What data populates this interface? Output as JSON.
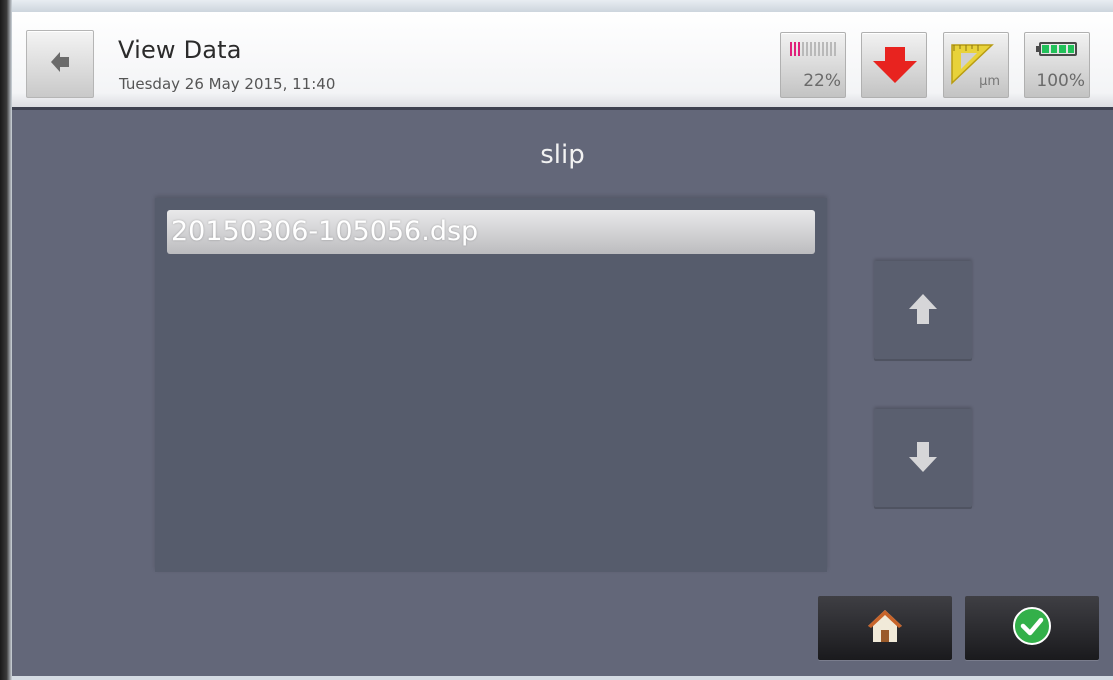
{
  "header": {
    "title": "View Data",
    "datetime": "Tuesday 26 May 2015, 11:40",
    "storage_label": "22%",
    "storage_fraction": 0.22,
    "units_label": "µm",
    "battery_label": "100%",
    "battery_fraction": 1.0
  },
  "main": {
    "folder_name": "slip",
    "files": [
      "20150306-105056.dsp"
    ]
  },
  "icons": {
    "back": "back-arrow-icon",
    "download": "download-arrow-icon",
    "units": "ruler-triangle-icon",
    "battery": "battery-icon",
    "up": "arrow-up-icon",
    "down": "arrow-down-icon",
    "home": "home-icon",
    "ok": "check-circle-icon"
  },
  "colors": {
    "background": "#636779",
    "header": "#ffffff",
    "download_arrow": "#e8231f",
    "storage_fill": "#e0207a",
    "battery_fill": "#22c15a",
    "confirm": "#33b04a"
  }
}
